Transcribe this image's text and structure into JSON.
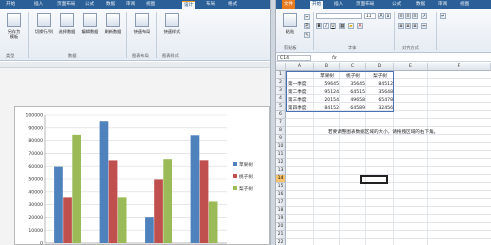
{
  "left_window": {
    "tabs": [
      "开始",
      "插入",
      "页面布局",
      "公式",
      "数据",
      "审阅",
      "视图",
      "设计",
      "布局",
      "格式"
    ],
    "ribbon_buttons": [
      {
        "label": "另存为\n模板",
        "icon": "template-icon"
      },
      {
        "label": "切换行/列",
        "icon": "switch-row-column-icon"
      },
      {
        "label": "选择数据",
        "icon": "select-data-icon"
      },
      {
        "label": "编辑数据",
        "icon": "edit-data-icon"
      },
      {
        "label": "刷新数据",
        "icon": "refresh-data-icon"
      },
      {
        "label": "快速布局",
        "icon": "quick-layout-icon"
      },
      {
        "label": "快速样式",
        "icon": "quick-style-icon"
      }
    ],
    "groups": [
      "类型",
      "数据",
      "图表布局",
      "图表样式"
    ]
  },
  "right_window": {
    "tabs": [
      "文件",
      "开始",
      "插入",
      "页面布局",
      "公式",
      "数据",
      "审阅",
      "视图"
    ],
    "ribbon": {
      "paste_label": "粘贴",
      "font_size": "11",
      "bold": "B",
      "italic": "I",
      "underline": "U",
      "groups": [
        "剪贴板",
        "字体",
        "对齐方式"
      ]
    },
    "name_box": "C14",
    "fx_label": "fx",
    "columns": [
      "A",
      "B",
      "C",
      "D",
      "E",
      "F"
    ],
    "rows": [
      "1",
      "2",
      "3",
      "4",
      "5",
      "6",
      "7",
      "8",
      "9",
      "10",
      "11",
      "12",
      "13",
      "14",
      "15",
      "16",
      "17",
      "18",
      "19",
      "20",
      "21",
      "22"
    ],
    "selected_row": "14",
    "table": {
      "headers": [
        "苹果树",
        "桃子树",
        "梨子树"
      ],
      "rows": [
        {
          "label": "第一季度",
          "values": [
            "59645",
            "35645",
            "84512"
          ]
        },
        {
          "label": "第二季度",
          "values": [
            "95124",
            "64515",
            "35648"
          ]
        },
        {
          "label": "第三季度",
          "values": [
            "20154",
            "49658",
            "65478"
          ]
        },
        {
          "label": "第四季度",
          "values": [
            "84152",
            "64589",
            "32456"
          ]
        }
      ]
    },
    "note": "若要调整图表数据区域的大小，请拖拽区域的右下角。"
  },
  "chart_data": {
    "type": "bar",
    "categories": [
      "第一季度",
      "第二季度",
      "第三季度",
      "第四季度"
    ],
    "series": [
      {
        "name": "苹果树",
        "color": "#4f81bd",
        "values": [
          59645,
          95124,
          20154,
          84152
        ]
      },
      {
        "name": "桃子树",
        "color": "#c0504d",
        "values": [
          35645,
          64515,
          49658,
          64589
        ]
      },
      {
        "name": "梨子树",
        "color": "#9bbb59",
        "values": [
          84512,
          35648,
          65478,
          32456
        ]
      }
    ],
    "ylim": [
      0,
      100000
    ],
    "yticks": [
      "0",
      "10000",
      "20000",
      "30000",
      "40000",
      "50000",
      "60000",
      "70000",
      "80000",
      "90000",
      "100000"
    ],
    "grid": true,
    "legend": "right"
  }
}
